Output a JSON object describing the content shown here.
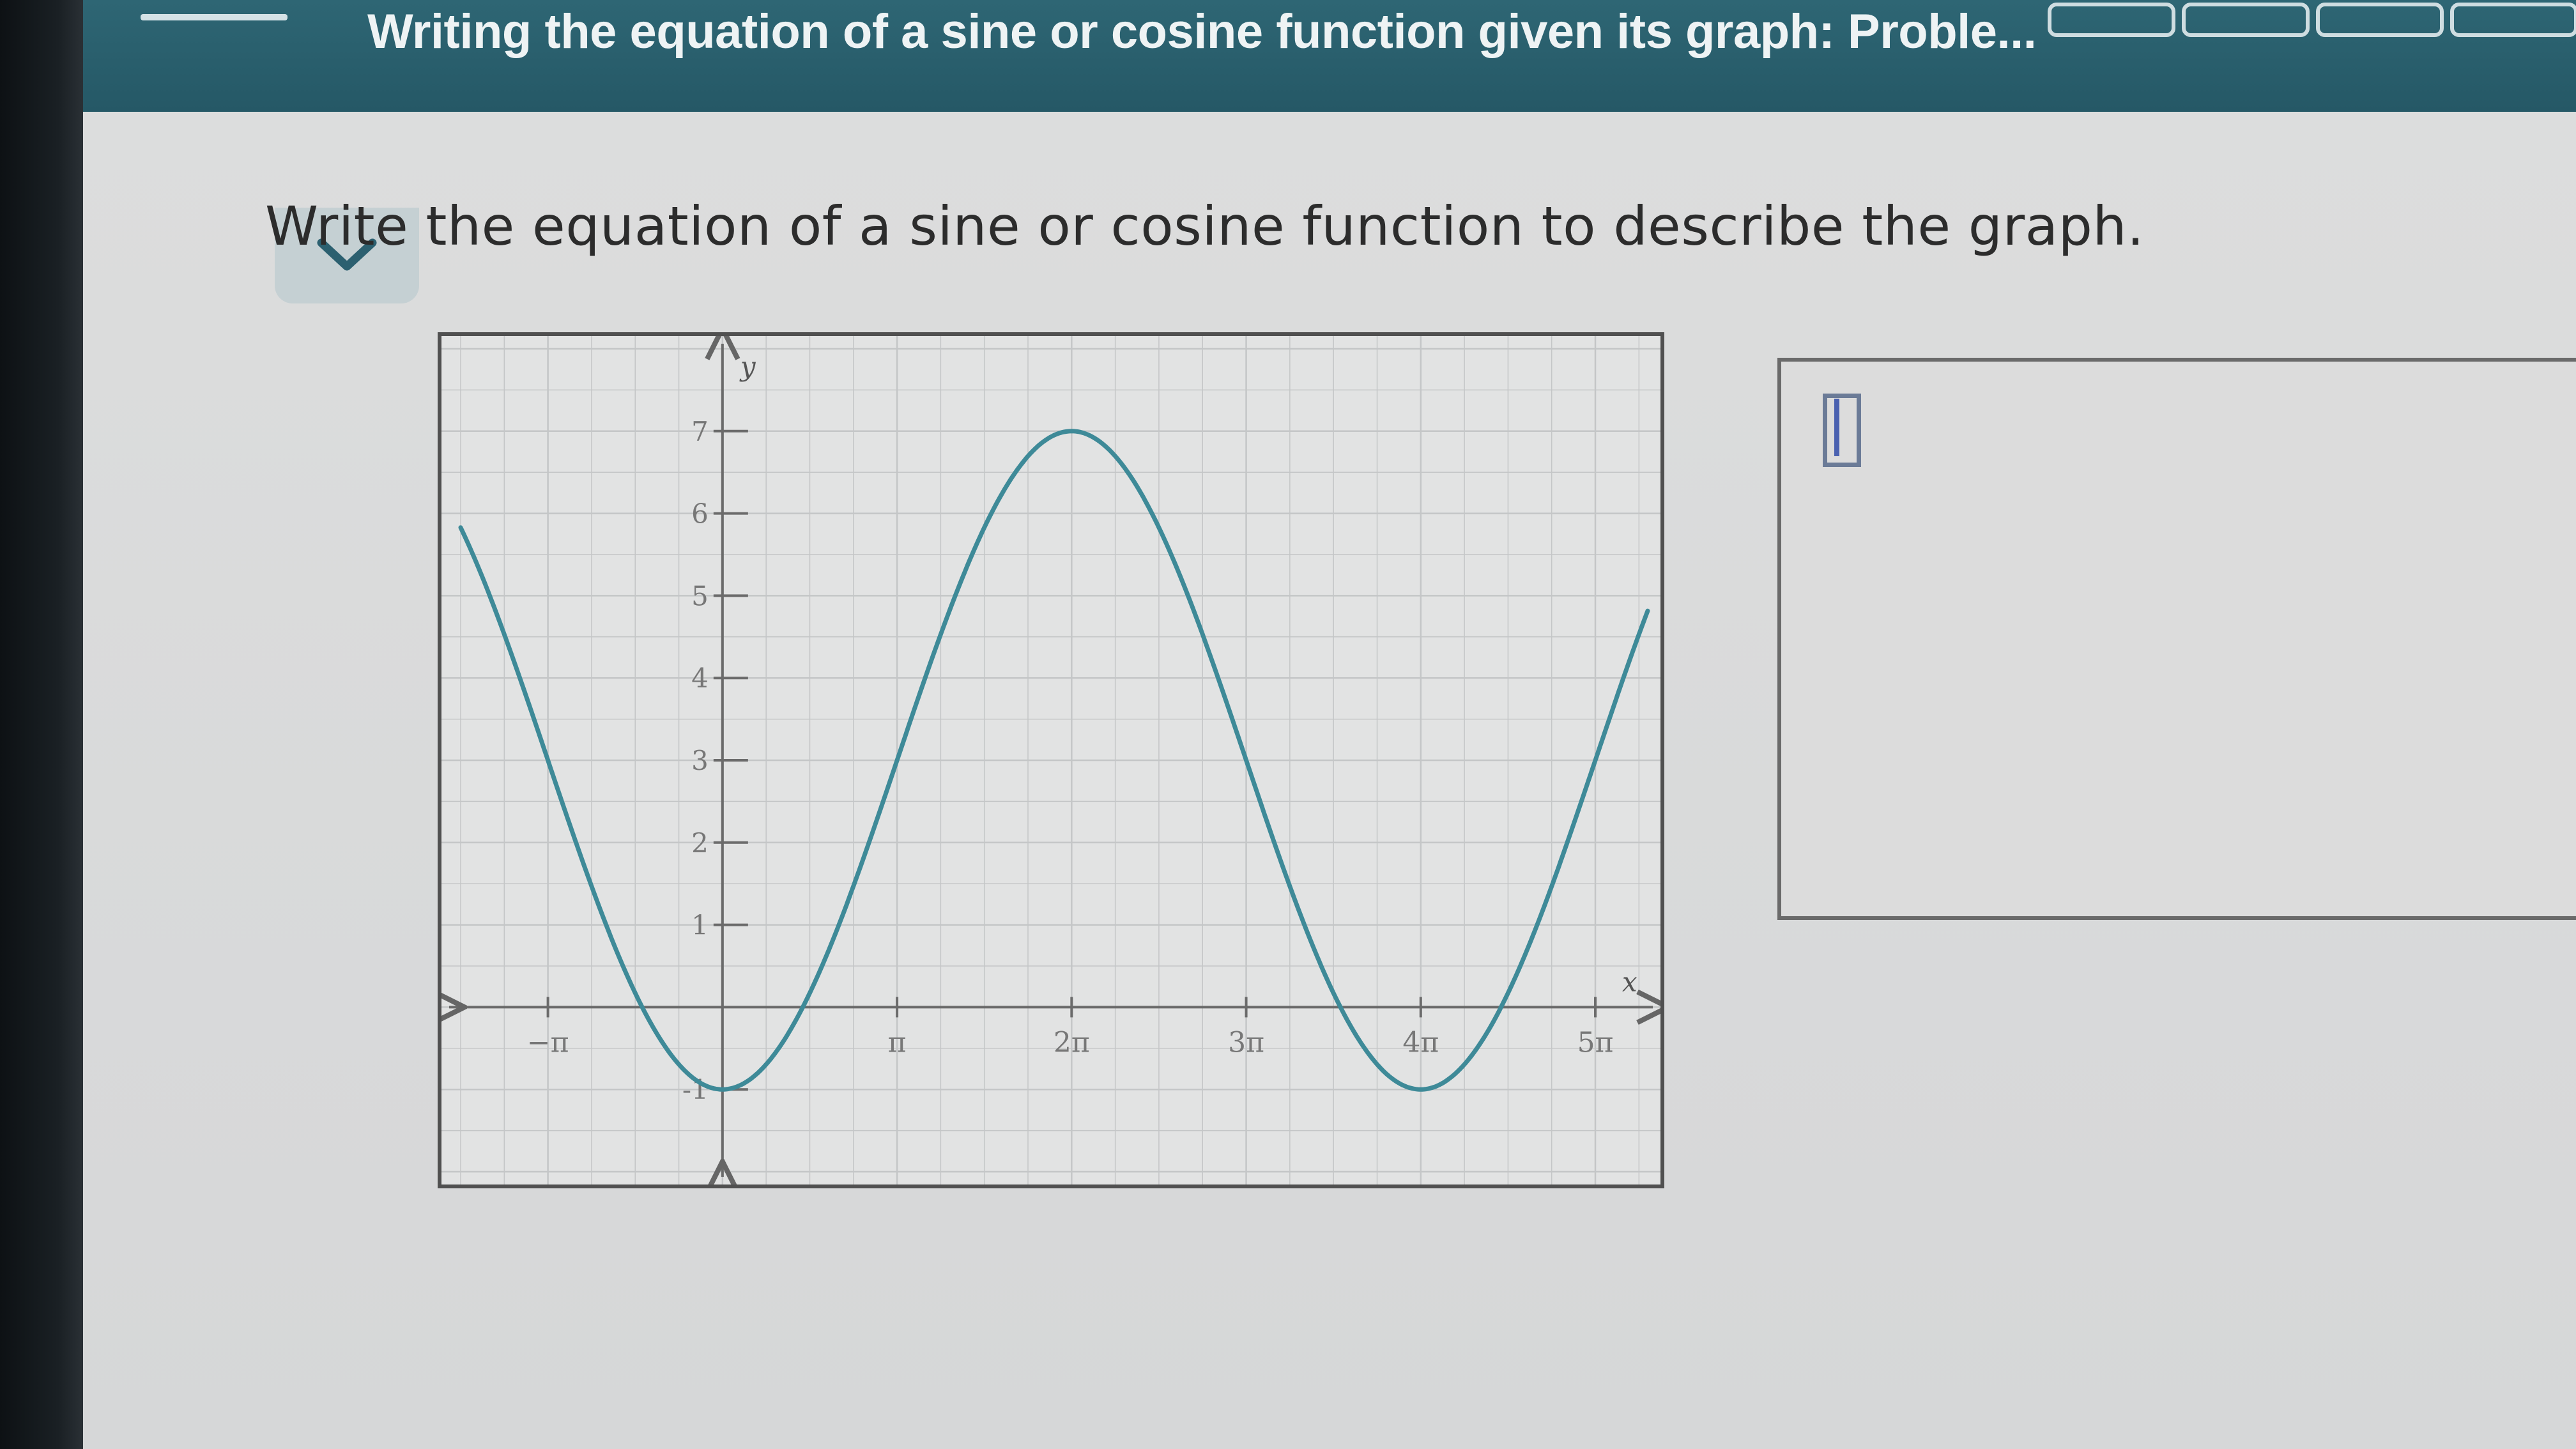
{
  "header": {
    "title": "Writing the equation of a sine or cosine function given its graph: Proble...",
    "progress_segments": 4
  },
  "question": {
    "prompt": "Write the equation of a sine or cosine function to describe the graph."
  },
  "graph": {
    "x_axis_label": "x",
    "y_axis_label": "y",
    "x_ticks": [
      {
        "value": -1,
        "label": "−π"
      },
      {
        "value": 1,
        "label": "π"
      },
      {
        "value": 2,
        "label": "2π"
      },
      {
        "value": 3,
        "label": "3π"
      },
      {
        "value": 4,
        "label": "4π"
      },
      {
        "value": 5,
        "label": "5π"
      }
    ],
    "y_ticks": [
      {
        "value": -1,
        "label": "-1"
      },
      {
        "value": 1,
        "label": "1"
      },
      {
        "value": 2,
        "label": "2"
      },
      {
        "value": 3,
        "label": "3"
      },
      {
        "value": 4,
        "label": "4"
      },
      {
        "value": 5,
        "label": "5"
      },
      {
        "value": 6,
        "label": "6"
      },
      {
        "value": 7,
        "label": "7"
      }
    ],
    "x_range_pi": [
      -1.5,
      5.3
    ],
    "y_range": [
      -2,
      8
    ],
    "curve_color": "#3e8a98",
    "curve": {
      "type": "cosine",
      "amplitude": 4,
      "midline": 3,
      "period_pi": 4,
      "max_at_pi": 2
    }
  },
  "answer": {
    "value": ""
  },
  "colors": {
    "topbar": "#2e6674",
    "curve": "#3e8a98",
    "grid": "#c4c6c7"
  }
}
